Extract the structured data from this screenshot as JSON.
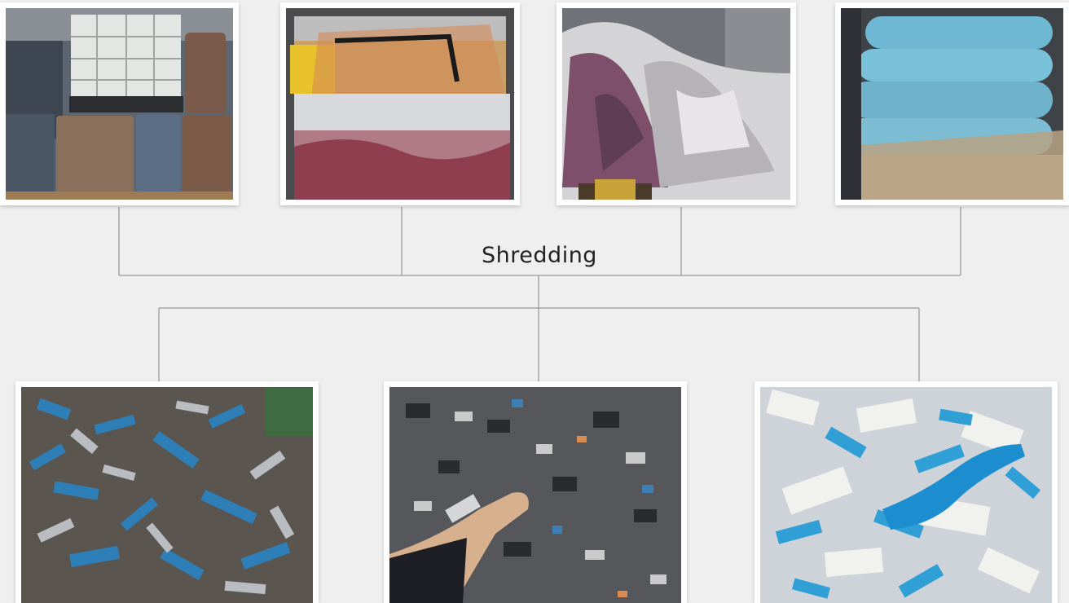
{
  "diagram": {
    "process_label": "Shredding"
  },
  "inputs": [
    {
      "icon": "drums-and-ibc-tote-photo"
    },
    {
      "icon": "baled-packaging-film-photo"
    },
    {
      "icon": "plastic-waste-pile-photo"
    },
    {
      "icon": "wrapped-film-rolls-photo"
    }
  ],
  "outputs": [
    {
      "icon": "shredded-metal-drum-pieces-photo"
    },
    {
      "icon": "shredded-mixed-plastic-photo"
    },
    {
      "icon": "shredded-blue-white-plastic-photo"
    }
  ]
}
